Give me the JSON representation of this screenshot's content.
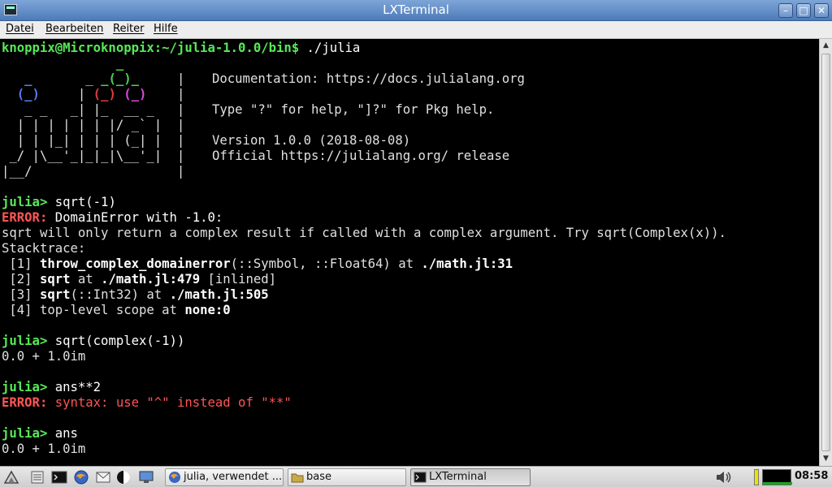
{
  "window": {
    "title": "LXTerminal"
  },
  "menubar": {
    "items": [
      "Datei",
      "Bearbeiten",
      "Reiter",
      "Hilfe"
    ]
  },
  "terminal": {
    "prompt_line": {
      "user_host": "knoppix@Microknoppix",
      "path": ":~/julia-1.0.0/bin$",
      "command": " ./julia"
    },
    "banner": {
      "documentation": "Documentation: https://docs.julialang.org",
      "help": "Type \"?\" for help, \"]?\" for Pkg help.",
      "version": "Version 1.0.0 (2018-08-08)",
      "release": "Official https://julialang.org/ release"
    },
    "session": [
      {
        "prompt": "julia>",
        "input": " sqrt(-1)"
      },
      {
        "error_label": "ERROR:",
        "error_text": " DomainError with -1.0:"
      },
      {
        "text": "sqrt will only return a complex result if called with a complex argument. Try sqrt(Complex(x))."
      },
      {
        "text": "Stacktrace:"
      },
      {
        "idx": " [1] ",
        "fn": "throw_complex_domainerror",
        "args": "(::Symbol, ::Float64) at ",
        "file": "./math.jl:31"
      },
      {
        "idx": " [2] ",
        "fn": "sqrt",
        "args": " at ",
        "file": "./math.jl:479",
        "extra": " [inlined]"
      },
      {
        "idx": " [3] ",
        "fn": "sqrt",
        "args": "(::Int32) at ",
        "file": "./math.jl:505"
      },
      {
        "idx": " [4] ",
        "fn_plain": "top-level scope at ",
        "file": "none:0"
      },
      {
        "prompt": "julia>",
        "input": " sqrt(complex(-1))"
      },
      {
        "text": "0.0 + 1.0im"
      },
      {
        "prompt": "julia>",
        "input": " ans**2"
      },
      {
        "error_label": "ERROR:",
        "error_text": " syntax: use \"^\" instead of \"**\""
      },
      {
        "prompt": "julia>",
        "input": " ans"
      },
      {
        "text": "0.0 + 1.0im"
      }
    ]
  },
  "taskbar": {
    "tasks": [
      "julia, verwendet ...",
      "base",
      "LXTerminal"
    ],
    "clock": "08:58"
  },
  "colors": {
    "prompt_green": "#57e857",
    "error_red": "#ff5555",
    "titlebar_blue": "#4d7bb8",
    "terminal_bg": "#000000"
  }
}
